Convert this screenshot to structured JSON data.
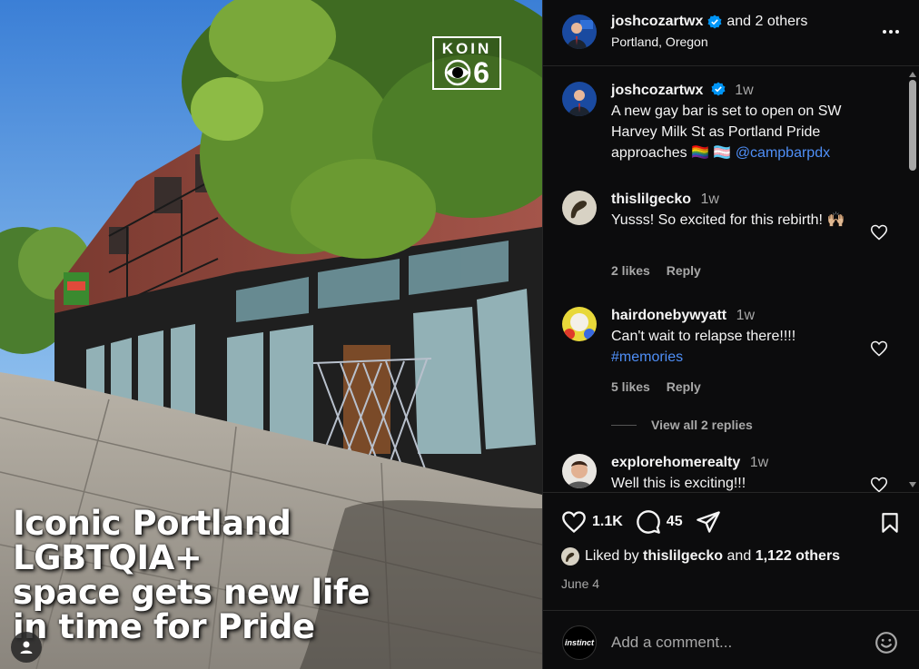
{
  "media": {
    "logo": {
      "top": "KOIN",
      "number": "6"
    },
    "headline": [
      "Iconic Portland",
      "LGBTQIA+",
      "space gets new life",
      "in time for Pride"
    ],
    "tag_icon": "user-icon"
  },
  "header": {
    "username": "joshcozartwx",
    "coauthors": "and 2 others",
    "location": "Portland, Oregon",
    "verified_color": "#0095f6"
  },
  "caption": {
    "username": "joshcozartwx",
    "time": "1w",
    "text": "A new gay bar is set to open on SW Harvey Milk St as Portland Pride approaches 🏳️‍🌈 🏳️‍⚧️",
    "mention": "@campbarpdx"
  },
  "comments": [
    {
      "username": "thislilgecko",
      "time": "1w",
      "text": "Yusss! So excited for this rebirth! 🙌🏼",
      "likes": "2 likes",
      "reply": "Reply"
    },
    {
      "username": "hairdonebywyatt",
      "time": "1w",
      "text": "Can't wait to relapse there!!!!",
      "hashtag": "#memories",
      "likes": "5 likes",
      "reply": "Reply",
      "view_replies": "View all 2 replies"
    },
    {
      "username": "explorehomerealty",
      "time": "1w",
      "text": "Well this is exciting!!!"
    }
  ],
  "actions": {
    "likes_count": "1.1K",
    "comments_count": "45",
    "liked_by_prefix": "Liked by",
    "liked_by_user": "thislilgecko",
    "liked_by_and": "and",
    "liked_by_others": "1,122 others",
    "date": "June 4"
  },
  "add_comment": {
    "avatar_text": "instinct",
    "placeholder": "Add a comment..."
  },
  "colors": {
    "panel_bg": "#0c0c0d",
    "link": "#4f8ff7",
    "muted": "#a8a8a8",
    "verified": "#0095f6"
  }
}
